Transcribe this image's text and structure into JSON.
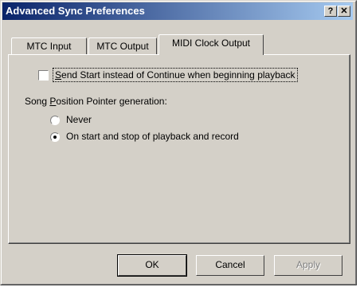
{
  "window": {
    "title": "Advanced Sync Preferences",
    "help_label": "?",
    "close_label": "✕"
  },
  "tabs": [
    {
      "label": "MTC Input"
    },
    {
      "label": "MTC Output"
    },
    {
      "label": "MIDI Clock Output",
      "active": true
    }
  ],
  "options": {
    "send_start_label_mnemonic": "S",
    "send_start_label_rest": "end Start instead of Continue when beginning playback",
    "send_start_checked": false,
    "spp_group_label_pre": "Song ",
    "spp_group_label_mnemonic": "P",
    "spp_group_label_rest": "osition Pointer generation:",
    "radios": [
      {
        "label": "Never",
        "selected": false
      },
      {
        "label": "On start and stop of playback and record",
        "selected": true
      }
    ]
  },
  "buttons": {
    "ok": "OK",
    "cancel": "Cancel",
    "apply": "Apply"
  }
}
